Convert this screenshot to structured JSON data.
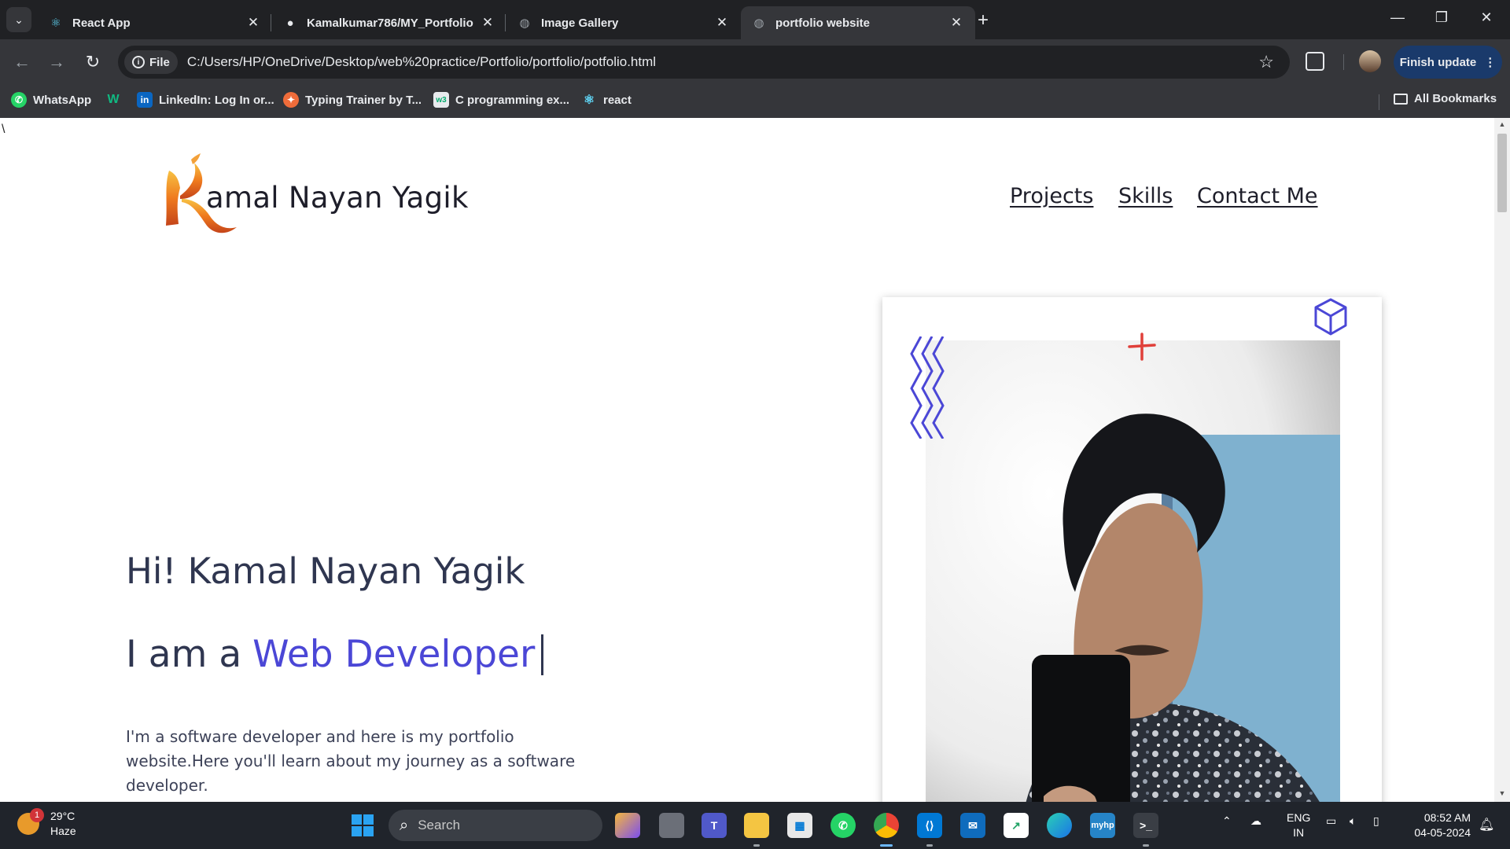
{
  "browser": {
    "tabs": [
      {
        "title": "React App",
        "active": false
      },
      {
        "title": "Kamalkumar786/MY_Portfolio",
        "active": false
      },
      {
        "title": "Image Gallery",
        "active": false
      },
      {
        "title": "portfolio website",
        "active": true
      }
    ],
    "address": {
      "scheme_label": "File",
      "url": "C:/Users/HP/OneDrive/Desktop/web%20practice/Portfolio/portfolio/potfolio.html"
    },
    "finish_update_label": "Finish update",
    "bookmarks": [
      {
        "label": "WhatsApp",
        "icon": "whatsapp-icon",
        "color": "#25d366"
      },
      {
        "label": "",
        "icon": "w-icon",
        "color": "#10b981"
      },
      {
        "label": "LinkedIn: Log In or...",
        "icon": "linkedin-icon",
        "color": "#0a66c2"
      },
      {
        "label": "Typing Trainer by T...",
        "icon": "typing-trainer-icon",
        "color": "#ef6c3a"
      },
      {
        "label": "C programming ex...",
        "icon": "w3schools-icon",
        "color": "#e8eaed"
      },
      {
        "label": "react",
        "icon": "react-icon",
        "color": "#61dafb"
      }
    ],
    "all_bookmarks_label": "All Bookmarks"
  },
  "page": {
    "stray_char": "\\",
    "logo_text": "amal Nayan Yagik",
    "nav": [
      "Projects",
      "Skills",
      "Contact Me"
    ],
    "hero": {
      "greeting": "Hi! Kamal Nayan Yagik",
      "role_prefix": "I am a",
      "role": "Web Developer",
      "description": "I'm a software developer and here is my portfolio website.Here you'll learn about my journey as a software developer."
    },
    "accent_color": "#4b47d6"
  },
  "taskbar": {
    "weather": {
      "temp": "29°C",
      "condition": "Haze",
      "badge": "1"
    },
    "search_placeholder": "Search",
    "lang": {
      "line1": "ENG",
      "line2": "IN"
    },
    "clock": {
      "time": "08:52 AM",
      "date": "04-05-2024"
    }
  }
}
